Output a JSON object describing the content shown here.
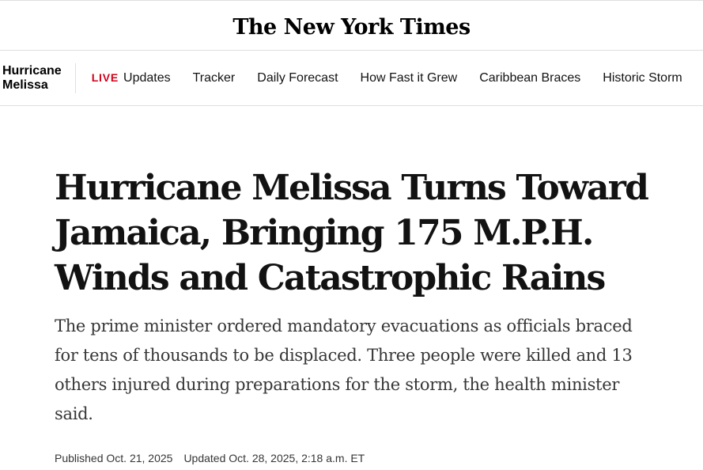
{
  "masthead": {
    "logo_text": "The New York Times"
  },
  "nav": {
    "section_title_line1": "Hurricane",
    "section_title_line2": "Melissa",
    "live_badge": "LIVE",
    "items": [
      {
        "label": "Updates"
      },
      {
        "label": "Tracker"
      },
      {
        "label": "Daily Forecast"
      },
      {
        "label": "How Fast it Grew"
      },
      {
        "label": "Caribbean Braces"
      },
      {
        "label": "Historic Storm"
      }
    ]
  },
  "article": {
    "headline": "Hurricane Melissa Turns Toward Jamaica, Bringing 175 M.P.H. Winds and Catastrophic Rains",
    "summary": "The prime minister ordered mandatory evacuations as officials braced for tens of thousands to be displaced. Three people were killed and 13 others injured during preparations for the storm, the health minister said.",
    "published": "Published Oct. 21, 2025",
    "updated": "Updated Oct. 28, 2025, 2:18 a.m. ET"
  },
  "colors": {
    "live_red": "#d0021b",
    "text": "#121212",
    "divider": "#dfdfdf"
  }
}
